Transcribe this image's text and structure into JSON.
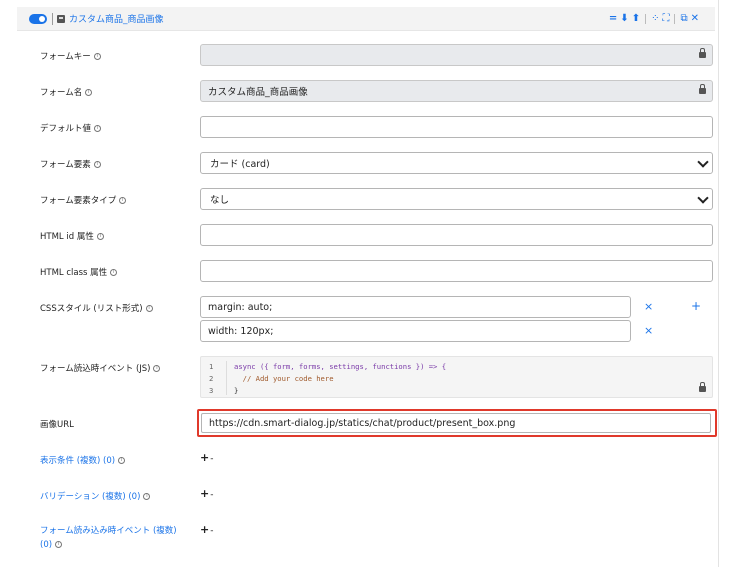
{
  "header": {
    "title": "カスタム商品_商品画像",
    "icons": [
      "equals-icon",
      "arrow-down-icon",
      "arrow-up-icon",
      "collapse-icon",
      "expand-icon",
      "copy-icon",
      "close-icon"
    ],
    "accent_color": "#1a73e8"
  },
  "fields": {
    "form_key": {
      "label": "フォームキー",
      "value": "",
      "locked": true
    },
    "form_name": {
      "label": "フォーム名",
      "value": "カスタム商品_商品画像",
      "locked": true
    },
    "default_value": {
      "label": "デフォルト値",
      "value": ""
    },
    "form_element": {
      "label": "フォーム要素",
      "value": "カード (card)"
    },
    "form_element_type": {
      "label": "フォーム要素タイプ",
      "value": "なし"
    },
    "html_id": {
      "label": "HTML id 属性",
      "value": ""
    },
    "html_class": {
      "label": "HTML class 属性",
      "value": ""
    },
    "css_style": {
      "label": "CSSスタイル (リスト形式)",
      "items": [
        "margin: auto;",
        "width: 120px;"
      ]
    },
    "on_load_js": {
      "label": "フォーム読込時イベント (JS)",
      "line_numbers": [
        "1",
        "2",
        "3"
      ],
      "lines": [
        "async ({ form, forms, settings, functions }) => {",
        "  // Add your code here",
        "}"
      ]
    },
    "image_url": {
      "label": "画像URL",
      "value": "https://cdn.smart-dialog.jp/statics/chat/product/present_box.png",
      "highlight_color": "#e0392b"
    },
    "display_conditions": {
      "label": "表示条件 (複数) (0)"
    },
    "validation": {
      "label": "バリデーション (複数) (0)"
    },
    "on_load_events": {
      "label": "フォーム読み込み時イベント (複数) (0)"
    }
  },
  "buttons": {
    "add": "+",
    "remove": "×",
    "plus_minus": "+",
    "minus": "-"
  }
}
